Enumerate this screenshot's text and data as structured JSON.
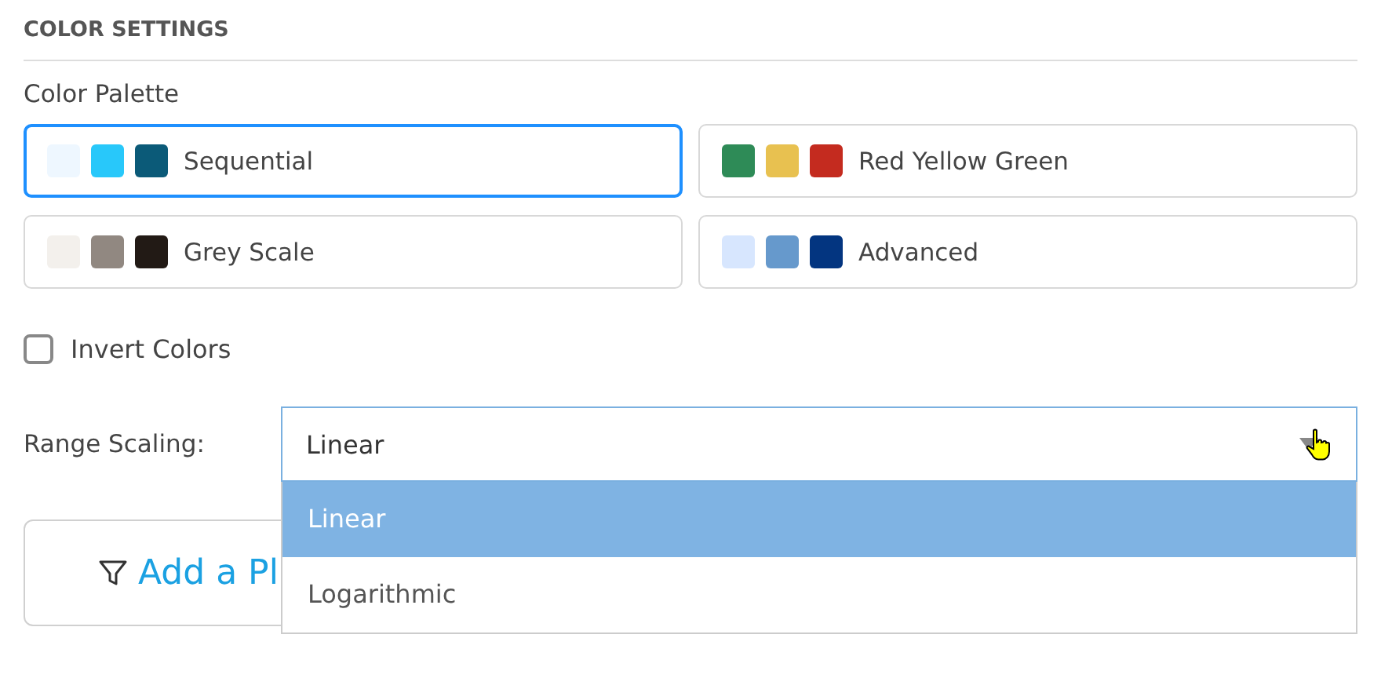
{
  "section_title": "COLOR SETTINGS",
  "palette_label": "Color Palette",
  "palettes": [
    {
      "label": "Sequential",
      "selected": true,
      "swatches": [
        {
          "color": "#eef7ff"
        },
        {
          "color": "#28c8fa"
        },
        {
          "color": "#0b5a78"
        }
      ]
    },
    {
      "label": "Red Yellow Green",
      "selected": false,
      "swatches": [
        {
          "color": "#2e8b57"
        },
        {
          "color": "#e8c150"
        },
        {
          "color": "#c42b1f"
        }
      ]
    },
    {
      "label": "Grey Scale",
      "selected": false,
      "swatches": [
        {
          "color": "#f3f0ec"
        },
        {
          "color": "#918881"
        },
        {
          "color": "#221a15"
        }
      ]
    },
    {
      "label": "Advanced",
      "selected": false,
      "swatches": [
        {
          "color": "#d7e6fe"
        },
        {
          "color": "#6699cc"
        },
        {
          "color": "#033580"
        }
      ]
    }
  ],
  "invert": {
    "label": "Invert Colors",
    "checked": false
  },
  "range_scaling": {
    "label": "Range Scaling:",
    "value": "Linear",
    "expanded": true,
    "options": [
      {
        "label": "Linear",
        "selected": true
      },
      {
        "label": "Logarithmic",
        "selected": false
      }
    ]
  },
  "add_button": {
    "label": "Add a Pl"
  }
}
